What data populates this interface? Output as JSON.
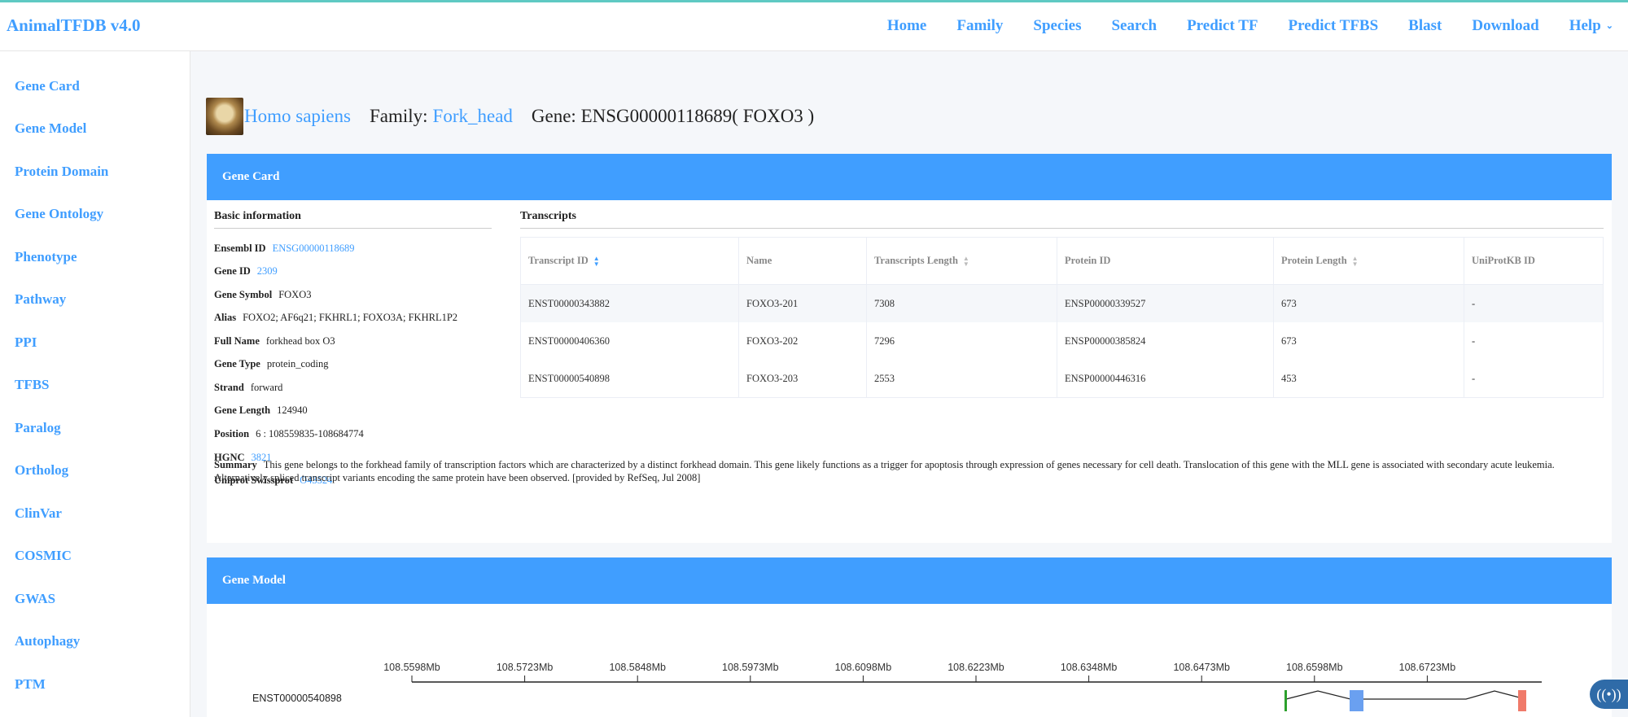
{
  "app": {
    "brand": "AnimalTFDB v4.0"
  },
  "nav": [
    "Home",
    "Family",
    "Species",
    "Search",
    "Predict TF",
    "Predict TFBS",
    "Blast",
    "Download",
    "Help"
  ],
  "sidebar": [
    "Gene Card",
    "Gene Model",
    "Protein Domain",
    "Gene Ontology",
    "Phenotype",
    "Pathway",
    "PPI",
    "TFBS",
    "Paralog",
    "Ortholog",
    "ClinVar",
    "COSMIC",
    "GWAS",
    "Autophagy",
    "PTM"
  ],
  "header": {
    "species": "Homo sapiens",
    "family_label": "Family:",
    "family": "Fork_head",
    "gene_text": "Gene: ENSG00000118689( FOXO3 )"
  },
  "gene_card": {
    "title": "Gene Card",
    "basic_title": "Basic information",
    "basic": [
      {
        "label": "Ensembl ID",
        "value": "ENSG00000118689",
        "link": true
      },
      {
        "label": "Gene ID",
        "value": "2309",
        "link": true
      },
      {
        "label": "Gene Symbol",
        "value": "FOXO3",
        "link": false
      },
      {
        "label": "Alias",
        "value": "FOXO2; AF6q21; FKHRL1; FOXO3A; FKHRL1P2",
        "link": false
      },
      {
        "label": "Full Name",
        "value": "forkhead box O3",
        "link": false
      },
      {
        "label": "Gene Type",
        "value": "protein_coding",
        "link": false
      },
      {
        "label": "Strand",
        "value": "forward",
        "link": false
      },
      {
        "label": "Gene Length",
        "value": "124940",
        "link": false
      },
      {
        "label": "Position",
        "value": "6 : 108559835-108684774",
        "link": false
      },
      {
        "label": "HGNC",
        "value": "3821",
        "link": true
      },
      {
        "label": "Uniprot Swissprot",
        "value": "O43524",
        "link": true
      }
    ],
    "transcripts_title": "Transcripts",
    "columns": [
      "Transcript ID",
      "Name",
      "Transcripts Length",
      "Protein ID",
      "Protein Length",
      "UniProtKB ID"
    ],
    "rows": [
      [
        "ENST00000343882",
        "FOXO3-201",
        "7308",
        "ENSP00000339527",
        "673",
        "-"
      ],
      [
        "ENST00000406360",
        "FOXO3-202",
        "7296",
        "ENSP00000385824",
        "673",
        "-"
      ],
      [
        "ENST00000540898",
        "FOXO3-203",
        "2553",
        "ENSP00000446316",
        "453",
        "-"
      ]
    ],
    "summary_label": "Summary",
    "summary": "This gene belongs to the forkhead family of transcription factors which are characterized by a distinct forkhead domain. This gene likely functions as a trigger for apoptosis through expression of genes necessary for cell death. Translocation of this gene with the MLL gene is associated with secondary acute leukemia. Alternatively spliced transcript variants encoding the same protein have been observed. [provided by RefSeq, Jul 2008]"
  },
  "gene_model": {
    "title": "Gene Model",
    "ticks": [
      "108.5598Mb",
      "108.5723Mb",
      "108.5848Mb",
      "108.5973Mb",
      "108.6098Mb",
      "108.6223Mb",
      "108.6348Mb",
      "108.6473Mb",
      "108.6598Mb",
      "108.6723Mb"
    ],
    "transcript": "ENST00000540898",
    "colors": {
      "start": "#2ca02c",
      "cds": "#6aa0f0",
      "end": "#f07a6a"
    }
  },
  "fab_icon": "broadcast-icon"
}
